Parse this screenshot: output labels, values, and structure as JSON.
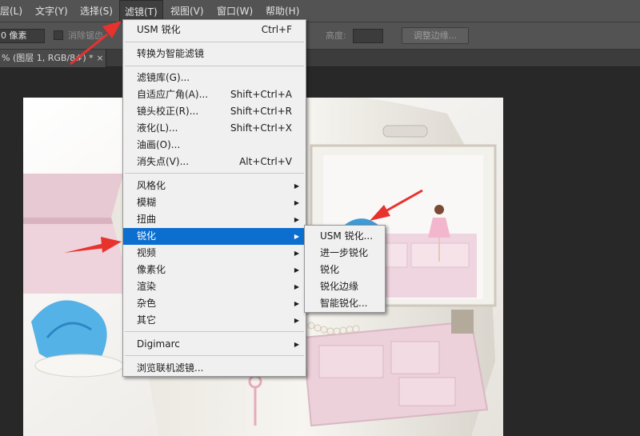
{
  "menubar": {
    "items": [
      {
        "label": "层(L)"
      },
      {
        "label": "文字(Y)"
      },
      {
        "label": "选择(S)"
      },
      {
        "label": "滤镜(T)"
      },
      {
        "label": "视图(V)"
      },
      {
        "label": "窗口(W)"
      },
      {
        "label": "帮助(H)"
      }
    ]
  },
  "options_bar": {
    "feather_value": "0 像素",
    "antialias_label": "消除锯齿",
    "height_label": "高度:",
    "height_value": "",
    "refine_edge_label": "调整边缘..."
  },
  "document_tab": {
    "title": "% (图层 1, RGB/8#) *",
    "close_glyph": "×"
  },
  "filter_menu": {
    "usm": {
      "label": "USM 锐化",
      "shortcut": "Ctrl+F"
    },
    "smart_filters": {
      "label": "转换为智能滤镜"
    },
    "gallery": {
      "label": "滤镜库(G)..."
    },
    "adaptive_wide": {
      "label": "自适应广角(A)...",
      "shortcut": "Shift+Ctrl+A"
    },
    "lens_correction": {
      "label": "镜头校正(R)...",
      "shortcut": "Shift+Ctrl+R"
    },
    "liquify": {
      "label": "液化(L)...",
      "shortcut": "Shift+Ctrl+X"
    },
    "oil_paint": {
      "label": "油画(O)..."
    },
    "vanishing_point": {
      "label": "消失点(V)...",
      "shortcut": "Alt+Ctrl+V"
    },
    "stylize": {
      "label": "风格化"
    },
    "blur": {
      "label": "模糊"
    },
    "distort": {
      "label": "扭曲"
    },
    "sharpen": {
      "label": "锐化"
    },
    "video": {
      "label": "视频"
    },
    "pixelate": {
      "label": "像素化"
    },
    "render": {
      "label": "渲染"
    },
    "noise": {
      "label": "杂色"
    },
    "other": {
      "label": "其它"
    },
    "digimarc": {
      "label": "Digimarc"
    },
    "browse_online": {
      "label": "浏览联机滤镜..."
    },
    "submenu_arrow": "▶"
  },
  "sharpen_submenu": {
    "items": [
      {
        "label": "USM 锐化..."
      },
      {
        "label": "进一步锐化"
      },
      {
        "label": "锐化"
      },
      {
        "label": "锐化边缘"
      },
      {
        "label": "智能锐化..."
      }
    ]
  },
  "colors": {
    "highlight": "#0c6fd0",
    "annotation_arrow": "#e8322e",
    "menu_bg": "#f0f0f0",
    "app_bg": "#535353"
  }
}
